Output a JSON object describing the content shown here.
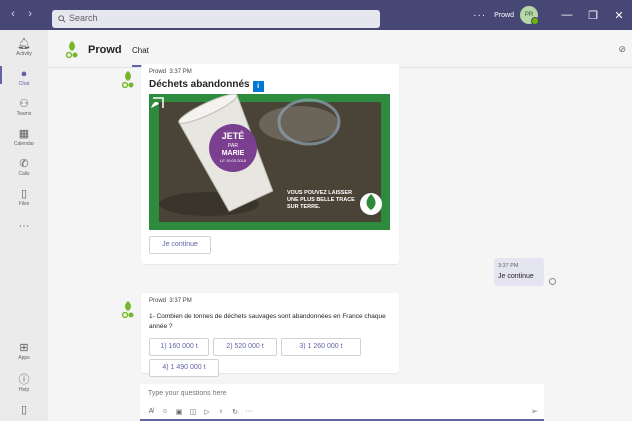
{
  "titlebar": {
    "search_placeholder": "Search",
    "more": "···",
    "user_name": "Prowd",
    "avatar_initials": "PR",
    "minimize": "—",
    "maximize": "❐",
    "close": "✕",
    "back": "‹",
    "forward": "›",
    "accent": "#464775"
  },
  "rail": {
    "items": [
      {
        "label": "Activity",
        "icon": "bell-icon"
      },
      {
        "label": "Chat",
        "icon": "chat-icon"
      },
      {
        "label": "Teams",
        "icon": "teams-icon"
      },
      {
        "label": "Calendar",
        "icon": "calendar-icon"
      },
      {
        "label": "Calls",
        "icon": "phone-icon"
      },
      {
        "label": "Files",
        "icon": "file-icon"
      },
      {
        "label": "···",
        "icon": "more-icon"
      },
      {
        "label": "Apps",
        "icon": "apps-icon"
      },
      {
        "label": "Help",
        "icon": "help-icon"
      }
    ]
  },
  "chat": {
    "name": "Prowd",
    "tab": "Chat"
  },
  "messages": {
    "m1": {
      "sender": "Prowd",
      "time": "3:37 PM",
      "title": "Déchets abandonnés",
      "badge": "i",
      "hero_cup_text_1": "JETÉ",
      "hero_cup_text_2": "PAR",
      "hero_cup_text_3": "MARIE",
      "hero_cup_text_4": "LE 19.03.2018",
      "hero_slogan_1": "VOUS POUVEZ LAISSER",
      "hero_slogan_2": "UNE PLUS BELLE TRACE",
      "hero_slogan_3": "SUR TERRE.",
      "button": "Je continue"
    },
    "mine": {
      "time": "3:37 PM",
      "text": "Je continue"
    },
    "m2": {
      "sender": "Prowd",
      "time": "3:37 PM",
      "question": "1- Combien de tonnes de déchets sauvages sont abandonnées en France chaque année ?",
      "options": [
        "1) 160 000 t",
        "2) 520 000 t",
        "3) 1 260 000 t",
        "4) 1 490 000 t"
      ]
    }
  },
  "compose": {
    "placeholder": "Type your questions here"
  }
}
